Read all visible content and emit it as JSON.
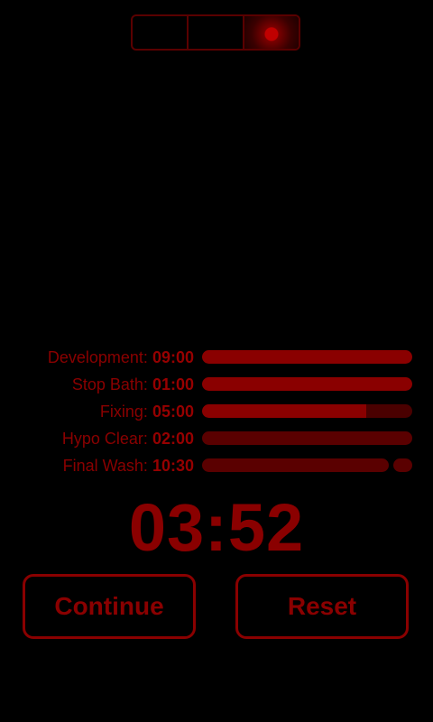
{
  "mode_switch": {
    "active_index": 2,
    "segment_count": 3
  },
  "steps": [
    {
      "name": "Development:",
      "time": "09:00",
      "progress": 1.0
    },
    {
      "name": "Stop Bath:",
      "time": "01:00",
      "progress": 1.0
    },
    {
      "name": "Fixing:",
      "time": "05:00",
      "progress": 0.78
    },
    {
      "name": "Hypo Clear:",
      "time": "02:00",
      "progress": 0.0
    },
    {
      "name": "Final Wash:",
      "time": "10:30",
      "progress": 0.0
    }
  ],
  "timer": {
    "display": "03:52"
  },
  "buttons": {
    "continue_label": "Continue",
    "reset_label": "Reset"
  },
  "colors": {
    "accent": "#8a0000",
    "track": "#4a0000",
    "background": "#000000"
  }
}
